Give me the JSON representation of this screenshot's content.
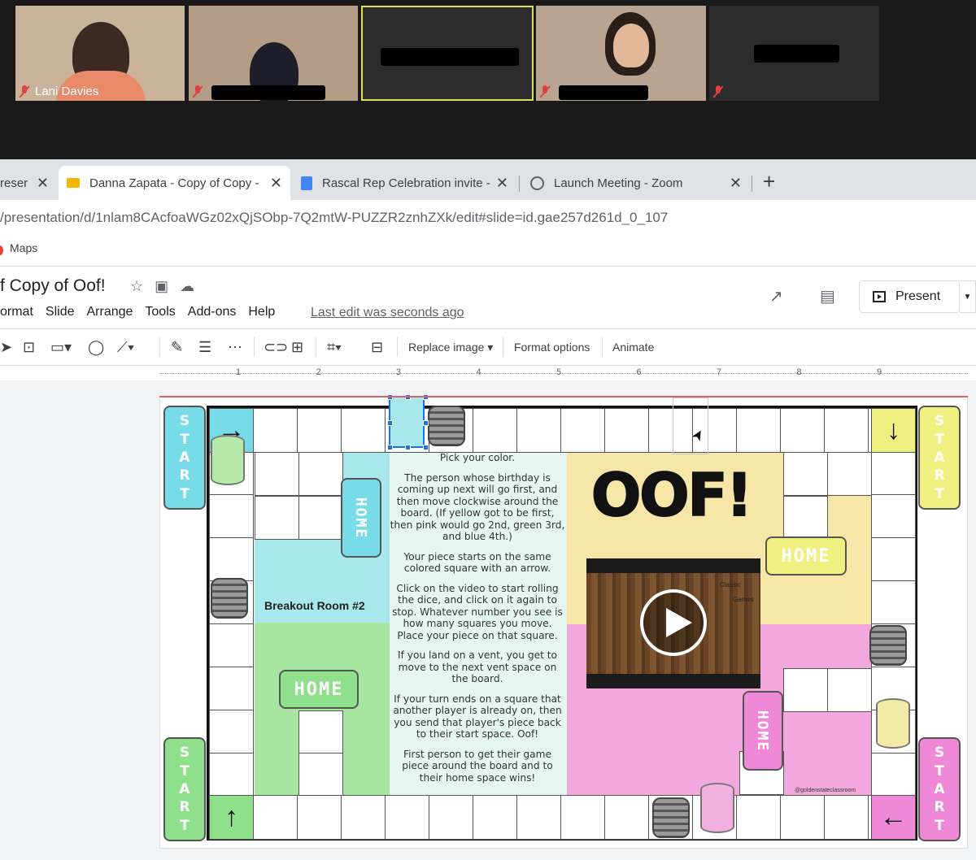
{
  "zoom": {
    "participants": [
      {
        "name": "Lani Davies",
        "muted": true
      },
      {
        "name": "",
        "muted": true
      },
      {
        "name": "",
        "muted": false
      },
      {
        "name": "",
        "muted": true
      },
      {
        "name": "",
        "muted": true
      }
    ]
  },
  "browser": {
    "tabs": [
      {
        "label": "reser"
      },
      {
        "label": "Danna Zapata - Copy of Copy -"
      },
      {
        "label": "Rascal Rep Celebration invite -"
      },
      {
        "label": "Launch Meeting - Zoom"
      }
    ],
    "url": "/presentation/d/1nlam8CAcfoaWGz02xQjSObp-7Q2mtW-PUZZR2znhZXk/edit#slide=id.gae257d261d_0_107",
    "bookmark": "Maps"
  },
  "slides": {
    "doc_title": "f Copy of Oof!",
    "menu": [
      "ormat",
      "Slide",
      "Arrange",
      "Tools",
      "Add-ons",
      "Help"
    ],
    "last_edit": "Last edit was seconds ago",
    "present_label": "Present",
    "toolbar": {
      "replace_image": "Replace image",
      "format_options": "Format options",
      "animate": "Animate"
    },
    "ruler_numbers": [
      "1",
      "2",
      "3",
      "4",
      "5",
      "6",
      "7",
      "8",
      "9"
    ]
  },
  "board": {
    "start_label": [
      "S",
      "T",
      "A",
      "R",
      "T"
    ],
    "home_label": "HOME",
    "breakout_label": "Breakout Room #2",
    "title": "OOF!",
    "video_labels": [
      "Classic",
      "Games"
    ],
    "credit": "@goldenstateclassroom",
    "rules": [
      "Pick your color.",
      "The person whose birthday is coming up next will go first, and then move clockwise around the board. (If yellow got to be first, then pink would go 2nd, green 3rd, and blue 4th.)",
      "Your piece starts on the same colored square with an arrow.",
      "Click on the video to start rolling the dice, and click on it again to stop. Whatever number you see is how many squares you move. Place your piece on that square.",
      "If you land on a vent, you get to move to the next vent space on the board.",
      "If your turn ends on a square that another player is already on, then you send that player's piece back to their start space. Oof!",
      "First person to get their game piece around the board and to their home space wins!"
    ],
    "colors": {
      "blue": "#a8e8ec",
      "yellow": "#f6e7a8",
      "green": "#a6e6a0",
      "pink": "#f2a8de",
      "start_blue": "#78dce8",
      "start_yellow": "#f0f080",
      "start_green": "#8ee08a",
      "start_pink": "#f088d8"
    }
  }
}
